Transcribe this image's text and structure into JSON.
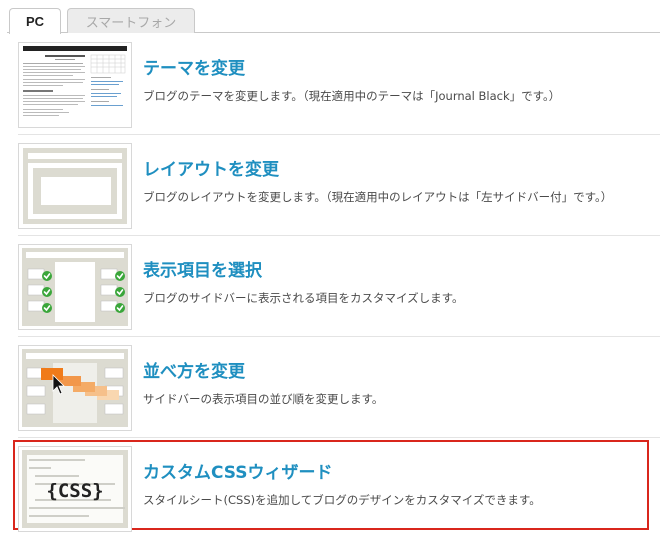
{
  "tabs": [
    {
      "label": "PC",
      "active": true
    },
    {
      "label": "スマートフォン",
      "active": false
    }
  ],
  "items": [
    {
      "title": "テーマを変更",
      "description": "ブログのテーマを変更します。（現在適用中のテーマは「Journal Black」です。）",
      "icon": "theme-thumbnail"
    },
    {
      "title": "レイアウトを変更",
      "description": "ブログのレイアウトを変更します。（現在適用中のレイアウトは「左サイドバー付」です。）",
      "icon": "layout-thumbnail"
    },
    {
      "title": "表示項目を選択",
      "description": "ブログのサイドバーに表示される項目をカスタマイズします。",
      "icon": "widgets-select-thumbnail"
    },
    {
      "title": "並べ方を変更",
      "description": "サイドバーの表示項目の並び順を変更します。",
      "icon": "widgets-order-thumbnail"
    },
    {
      "title": "カスタムCSSウィザード",
      "description": "スタイルシート(CSS)を追加してブログのデザインをカスタマイズできます。",
      "icon": "css-thumbnail",
      "selected": true
    }
  ],
  "css_thumb_text": "{CSS}",
  "colors": {
    "title": "#1f8fc0",
    "selected_border": "#d9261c",
    "check": "#3aa63a",
    "drag_orange": "#f07b1a"
  }
}
